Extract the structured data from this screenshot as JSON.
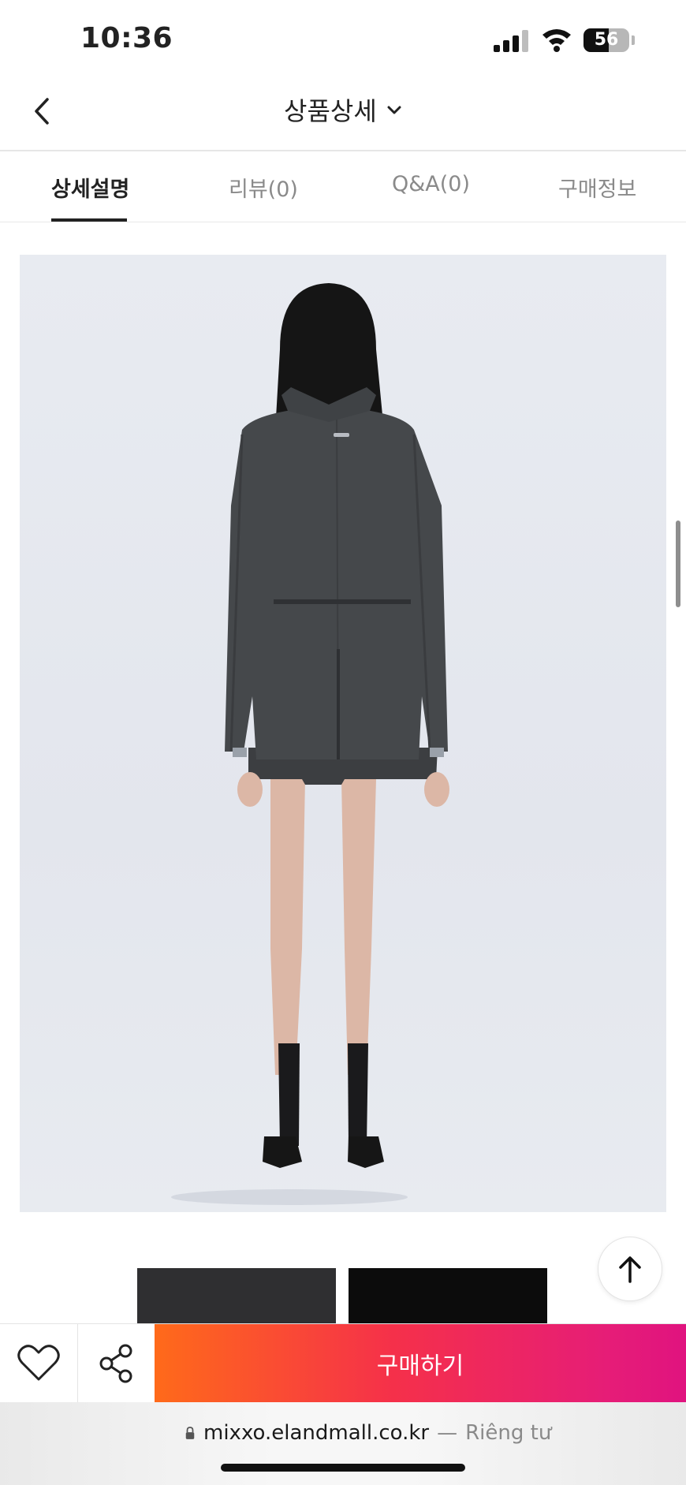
{
  "status_bar": {
    "time": "10:36",
    "battery": "56",
    "battery_level_percent": 56
  },
  "header": {
    "title": "상품상세",
    "back_icon": "chevron-left-icon",
    "title_icon": "chevron-down-icon"
  },
  "tabs": [
    {
      "label": "상세설명",
      "active": true
    },
    {
      "label": "리뷰(0)",
      "active": false
    },
    {
      "label": "Q&A(0)",
      "active": false
    },
    {
      "label": "구매정보",
      "active": false
    }
  ],
  "bottom_bar": {
    "buy_label": "구매하기",
    "wish_icon": "heart-icon",
    "share_icon": "share-icon",
    "buy_gradient": [
      "#ff6a1a",
      "#e0137f"
    ]
  },
  "browser": {
    "domain": "mixxo.elandmall.co.kr",
    "separator": "—",
    "privacy_label": "Riêng tư"
  }
}
